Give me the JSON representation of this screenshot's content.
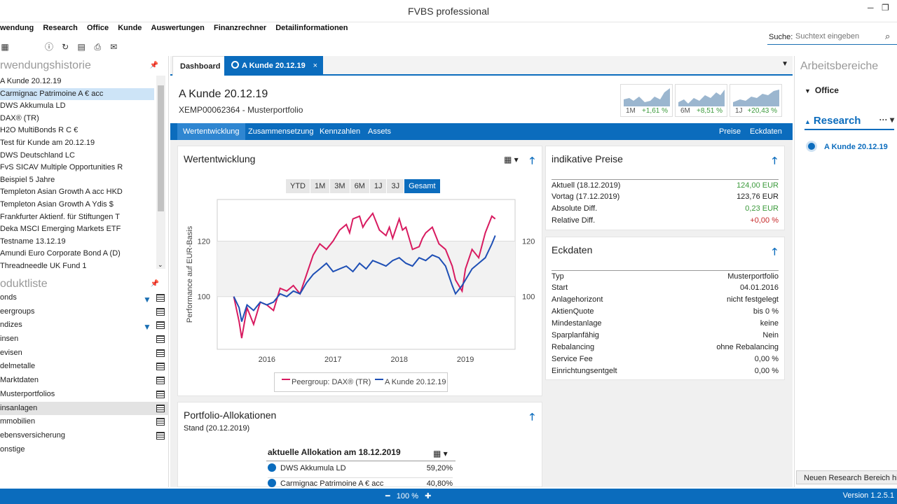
{
  "app": {
    "title": "FVBS professional"
  },
  "menu": [
    "wendung",
    "Research",
    "Office",
    "Kunde",
    "Auswertungen",
    "Finanzrechner",
    "Detailinformationen"
  ],
  "search": {
    "label": "Suche:",
    "placeholder": "Suchtext eingeben"
  },
  "left": {
    "history_title": "rwendungshistorie",
    "history": [
      "A Kunde 20.12.19",
      "Carmignac Patrimoine A € acc",
      "DWS Akkumula LD",
      "DAX® (TR)",
      "H2O MultiBonds R C €",
      "Test für Kunde am 20.12.19",
      "DWS Deutschland LC",
      "FvS SICAV Multiple Opportunities R",
      "Beispiel 5 Jahre",
      "Templeton Asian Growth A acc HKD",
      "Templeton Asian Growth A Ydis $",
      "Frankfurter Aktienf. für Stiftungen T",
      "Deka MSCI Emerging Markets ETF",
      "Testname 13.12.19",
      "Amundi Euro Corporate Bond A (D)",
      "Threadneedle UK Fund 1"
    ],
    "products_title": "oduktliste",
    "products": [
      "onds",
      "eergroups",
      "ndizes",
      "insen",
      "evisen",
      "delmetalle",
      "Marktdaten",
      "Musterportfolios",
      "insanlagen",
      "mmobilien",
      "ebensversicherung",
      "onstige"
    ]
  },
  "tabs": {
    "dashboard": "Dashboard",
    "active": "A Kunde 20.12.19",
    "close": "×"
  },
  "header": {
    "title": "A Kunde 20.12.19",
    "subtitle": "XEMP00062364  -  Musterportfolio"
  },
  "sparks": [
    {
      "period": "1M",
      "value": "+1,61 %"
    },
    {
      "period": "6M",
      "value": "+8,51 %"
    },
    {
      "period": "1J",
      "value": "+20,43 %"
    }
  ],
  "subnav": {
    "items": [
      "Wertentwicklung",
      "Zusammensetzung",
      "Kennzahlen",
      "Assets"
    ],
    "right": [
      "Preise",
      "Eckdaten"
    ]
  },
  "wert": {
    "title": "Wertentwicklung",
    "ranges": [
      "YTD",
      "1M",
      "3M",
      "6M",
      "1J",
      "3J",
      "Gesamt"
    ],
    "legend": [
      "Peergroup: DAX® (TR)",
      "A Kunde 20.12.19"
    ]
  },
  "chart_data": {
    "type": "line",
    "ylabel": "Performance auf EUR-Basis",
    "xticks": [
      "2016",
      "2017",
      "2018",
      "2019"
    ],
    "yticks": [
      100,
      120
    ],
    "ylim": [
      81,
      135
    ],
    "xlim": [
      2015.25,
      2019.75
    ],
    "series": [
      {
        "name": "Peergroup: DAX® (TR)",
        "color": "#d81b60",
        "x": [
          2015.5,
          2015.58,
          2015.62,
          2015.7,
          2015.8,
          2015.9,
          2016.0,
          2016.1,
          2016.15,
          2016.2,
          2016.3,
          2016.4,
          2016.5,
          2016.6,
          2016.7,
          2016.8,
          2016.9,
          2017.0,
          2017.1,
          2017.2,
          2017.25,
          2017.3,
          2017.4,
          2017.45,
          2017.5,
          2017.6,
          2017.7,
          2017.8,
          2017.85,
          2017.9,
          2018.0,
          2018.05,
          2018.1,
          2018.2,
          2018.3,
          2018.35,
          2018.4,
          2018.5,
          2018.6,
          2018.7,
          2018.8,
          2018.85,
          2018.95,
          2019.0,
          2019.1,
          2019.2,
          2019.3,
          2019.4,
          2019.45
        ],
        "y": [
          100,
          91,
          85,
          96,
          90,
          98,
          97,
          95,
          99,
          103,
          102,
          104,
          101,
          108,
          115,
          119,
          117,
          120,
          124,
          126,
          123,
          128,
          129,
          125,
          127,
          130,
          124,
          122,
          125,
          121,
          128,
          124,
          125,
          117,
          118,
          121,
          123,
          125,
          119,
          117,
          111,
          106,
          102,
          110,
          117,
          114,
          123,
          129,
          128
        ]
      },
      {
        "name": "A Kunde 20.12.19",
        "color": "#1e4fb5",
        "x": [
          2015.5,
          2015.58,
          2015.62,
          2015.7,
          2015.8,
          2015.9,
          2016.0,
          2016.1,
          2016.2,
          2016.3,
          2016.4,
          2016.5,
          2016.6,
          2016.7,
          2016.8,
          2016.9,
          2017.0,
          2017.1,
          2017.2,
          2017.3,
          2017.4,
          2017.5,
          2017.6,
          2017.7,
          2017.8,
          2017.9,
          2018.0,
          2018.1,
          2018.2,
          2018.3,
          2018.4,
          2018.5,
          2018.6,
          2018.7,
          2018.8,
          2018.85,
          2018.95,
          2019.0,
          2019.1,
          2019.2,
          2019.3,
          2019.4,
          2019.45
        ],
        "y": [
          100,
          96,
          91,
          97,
          95,
          98,
          97,
          98,
          101,
          100,
          102,
          101,
          105,
          108,
          110,
          112,
          109,
          110,
          111,
          109,
          112,
          110,
          113,
          112,
          111,
          113,
          114,
          112,
          111,
          114,
          113,
          115,
          114,
          111,
          104,
          101,
          104,
          106,
          110,
          112,
          114,
          119,
          122
        ]
      }
    ]
  },
  "prices": {
    "title": "indikative Preise",
    "rows": [
      {
        "k": "Aktuell (18.12.2019)",
        "v": "124,00 EUR",
        "c": "#3b9a3b"
      },
      {
        "k": "Vortag (17.12.2019)",
        "v": "123,76 EUR",
        "c": "#222"
      },
      {
        "k": "Absolute Diff.",
        "v": "0,23 EUR",
        "c": "#3b9a3b"
      },
      {
        "k": "Relative Diff.",
        "v": "+0,00 %",
        "c": "#c62828"
      }
    ]
  },
  "eckdaten": {
    "title": "Eckdaten",
    "rows": [
      {
        "k": "Typ",
        "v": "Musterportfolio"
      },
      {
        "k": "Start",
        "v": "04.01.2016"
      },
      {
        "k": "Anlagehorizont",
        "v": "nicht festgelegt"
      },
      {
        "k": "AktienQuote",
        "v": "bis 0 %"
      },
      {
        "k": "Mindestanlage",
        "v": "keine"
      },
      {
        "k": "Sparplanfähig",
        "v": "Nein"
      },
      {
        "k": "Rebalancing",
        "v": "ohne Rebalancing"
      },
      {
        "k": "Service Fee",
        "v": "0,00 %"
      },
      {
        "k": "Einrichtungsentgelt",
        "v": "0,00 %"
      }
    ]
  },
  "alloc": {
    "title": "Portfolio-Allokationen",
    "stand": "Stand (20.12.2019)",
    "sub": "aktuelle Allokation am 18.12.2019",
    "rows": [
      {
        "k": "DWS Akkumula LD",
        "v": "59,20%"
      },
      {
        "k": "Carmignac Patrimoine A € acc",
        "v": "40,80%"
      }
    ]
  },
  "right": {
    "title": "Arbeitsbereiche",
    "office": "Office",
    "research": "Research",
    "item": "A Kunde 20.12.19",
    "new": "Neuen Research Bereich hinzufügen"
  },
  "status": {
    "zoom": "100 %",
    "version": "Version 1.2.5.1"
  }
}
